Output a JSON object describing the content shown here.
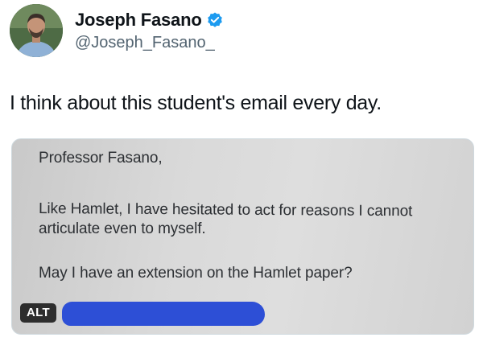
{
  "author": {
    "display_name": "Joseph Fasano",
    "handle": "@Joseph_Fasano_",
    "avatar_icon": "avatar",
    "verified_icon": "verified-badge-icon",
    "verified_color": "#1d9bf0"
  },
  "tweet": {
    "text": "I think about this student's email every day."
  },
  "media": {
    "email_lines": [
      "Professor Fasano,",
      "Like Hamlet, I have hesitated to act for reasons I cannot",
      "articulate even to myself.",
      "May I have an extension on the Hamlet paper?"
    ],
    "alt_badge": "ALT",
    "redaction_color": "#2d4fd6"
  }
}
